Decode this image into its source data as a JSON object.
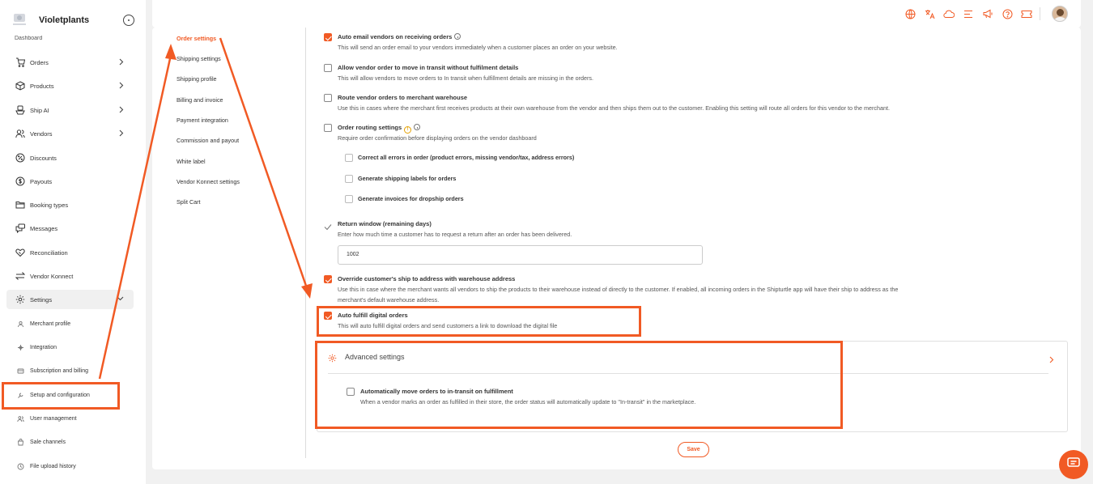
{
  "brand": {
    "name": "Violetplants"
  },
  "sidebar": {
    "partial_item": "Dashboard",
    "items": [
      {
        "label": "Orders",
        "icon": "cart-icon",
        "chevron": true
      },
      {
        "label": "Products",
        "icon": "box-icon",
        "chevron": true
      },
      {
        "label": "Ship AI",
        "icon": "ship-icon",
        "chevron": true
      },
      {
        "label": "Vendors",
        "icon": "vendors-icon",
        "chevron": true
      },
      {
        "label": "Discounts",
        "icon": "discount-icon",
        "chevron": false
      },
      {
        "label": "Payouts",
        "icon": "dollar-icon",
        "chevron": false
      },
      {
        "label": "Booking types",
        "icon": "folder-icon",
        "chevron": false
      },
      {
        "label": "Messages",
        "icon": "messages-icon",
        "chevron": false
      },
      {
        "label": "Reconciliation",
        "icon": "handshake-icon",
        "chevron": false
      },
      {
        "label": "Vendor Konnect",
        "icon": "transfer-icon",
        "chevron": false
      },
      {
        "label": "Settings",
        "icon": "gear-icon",
        "chevron": true
      }
    ],
    "sub_items": [
      {
        "label": "Merchant profile"
      },
      {
        "label": "Integration"
      },
      {
        "label": "Subscription and billing"
      },
      {
        "label": "Setup and configuration"
      },
      {
        "label": "User management"
      },
      {
        "label": "Sale channels"
      },
      {
        "label": "File upload history"
      }
    ]
  },
  "submenu": {
    "items": [
      "Order settings",
      "Shipping settings",
      "Shipping profile",
      "Billing and invoice",
      "Payment integration",
      "Commission and payout",
      "White label",
      "Vendor Konnect settings",
      "Split Cart"
    ],
    "active": "Order settings"
  },
  "settings": {
    "auto_email": {
      "title": "Auto email vendors on receiving orders",
      "desc": "This will send an order email to your vendors immediately when a customer places an order on your website.",
      "checked": true
    },
    "allow_transit": {
      "title": "Allow vendor order to move in transit without fulfilment details",
      "desc": "This will allow vendors to move orders to In transit when fulfillment details are missing in the orders.",
      "checked": false
    },
    "route_warehouse": {
      "title": "Route vendor orders to merchant warehouse",
      "desc": "Use this in cases where the merchant first receives products at their own warehouse from the vendor and then ships them out to the customer. Enabling this setting will route all orders for this vendor to the merchant.",
      "checked": false
    },
    "order_routing": {
      "title": "Order routing settings",
      "desc": "Require order confirmation before displaying orders on the vendor dashboard",
      "checked": false,
      "sub": [
        "Correct all errors in order (product errors, missing vendor/tax, address errors)",
        "Generate shipping labels for orders",
        "Generate invoices for dropship orders"
      ]
    },
    "return_window": {
      "title": "Return window (remaining days)",
      "desc": "Enter how much time a customer has to request a return after an order has been delivered.",
      "value": "1002"
    },
    "override_ship": {
      "title": "Override customer's ship to address with warehouse address",
      "desc_line1": "Use this in case where the merchant wants all vendors to ship the products to their warehouse instead of directly to the customer. If enabled, all incoming orders in the Shipturtle app will have their ship to address as the",
      "desc_line2": "merchant's default warehouse address.",
      "checked": true
    },
    "auto_fulfill": {
      "title": "Auto fulfill digital orders",
      "desc": "This will auto fulfill digital orders and send customers a link to download the digital file",
      "checked": true
    },
    "advanced": {
      "title": "Advanced settings",
      "auto_transit": {
        "title": "Automatically move orders to in-transit on fulfillment",
        "desc": "When a vendor marks an order as fulfilled in their store, the order status will automatically update to \"In-transit\" in the marketplace.",
        "checked": false
      }
    }
  },
  "save_label": "Save",
  "colors": {
    "accent": "#f15a24"
  },
  "topbar_icons": [
    "globe-icon",
    "translate-icon",
    "cloud-icon",
    "menu-lines-icon",
    "megaphone-icon",
    "help-icon",
    "ticket-icon"
  ]
}
